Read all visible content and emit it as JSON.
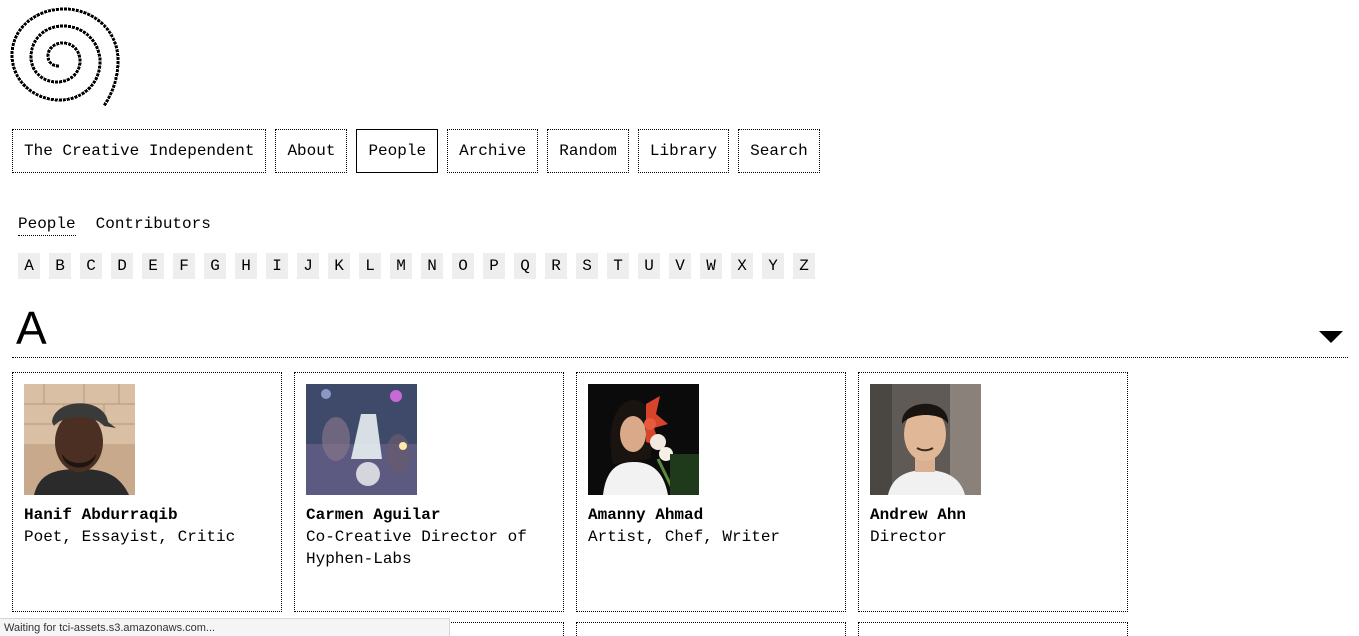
{
  "logo": {
    "icon": "spiral-logo-icon"
  },
  "nav": {
    "items": [
      {
        "label": "The Creative Independent",
        "active": false
      },
      {
        "label": "About",
        "active": false
      },
      {
        "label": "People",
        "active": true
      },
      {
        "label": "Archive",
        "active": false
      },
      {
        "label": "Random",
        "active": false
      },
      {
        "label": "Library",
        "active": false
      },
      {
        "label": "Search",
        "active": false
      }
    ]
  },
  "subnav": {
    "items": [
      {
        "label": "People",
        "current": true
      },
      {
        "label": "Contributors",
        "current": false
      }
    ]
  },
  "letters": [
    "A",
    "B",
    "C",
    "D",
    "E",
    "F",
    "G",
    "H",
    "I",
    "J",
    "K",
    "L",
    "M",
    "N",
    "O",
    "P",
    "Q",
    "R",
    "S",
    "T",
    "U",
    "V",
    "W",
    "X",
    "Y",
    "Z"
  ],
  "section": {
    "heading": "A",
    "toggle_icon": "triangle-down-icon"
  },
  "people": [
    {
      "name": "Hanif Abdurraqib",
      "role": "Poet, Essayist, Critic"
    },
    {
      "name": "Carmen Aguilar",
      "role": "Co-Creative Director of Hyphen-Labs"
    },
    {
      "name": "Amanny Ahmad",
      "role": "Artist, Chef, Writer"
    },
    {
      "name": "Andrew Ahn",
      "role": "Director"
    }
  ],
  "status": {
    "text": "Waiting for tci-assets.s3.amazonaws.com..."
  }
}
